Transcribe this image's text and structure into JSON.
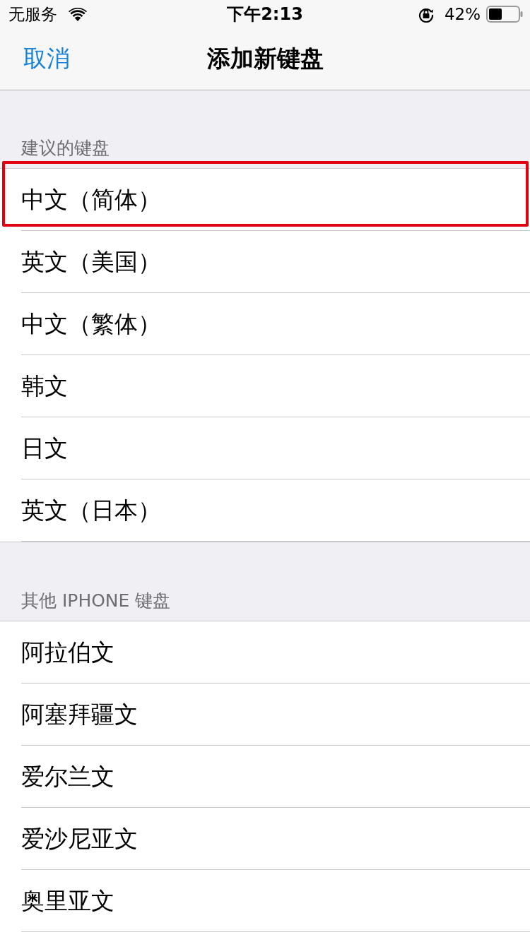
{
  "status_bar": {
    "carrier": "无服务",
    "time": "下午2:13",
    "battery": "42%"
  },
  "nav_bar": {
    "cancel": "取消",
    "title": "添加新键盘"
  },
  "sections": [
    {
      "header": "建议的键盘",
      "rows": [
        {
          "label": "中文（简体）",
          "highlighted": true
        },
        {
          "label": "英文（美国）",
          "highlighted": false
        },
        {
          "label": "中文（繁体）",
          "highlighted": false
        },
        {
          "label": "韩文",
          "highlighted": false
        },
        {
          "label": "日文",
          "highlighted": false
        },
        {
          "label": "英文（日本）",
          "highlighted": false
        }
      ]
    },
    {
      "header": "其他 IPHONE 键盘",
      "rows": [
        {
          "label": "阿拉伯文",
          "highlighted": false
        },
        {
          "label": "阿塞拜疆文",
          "highlighted": false
        },
        {
          "label": "爱尔兰文",
          "highlighted": false
        },
        {
          "label": "爱沙尼亚文",
          "highlighted": false
        },
        {
          "label": "奥里亚文",
          "highlighted": false
        }
      ]
    }
  ]
}
